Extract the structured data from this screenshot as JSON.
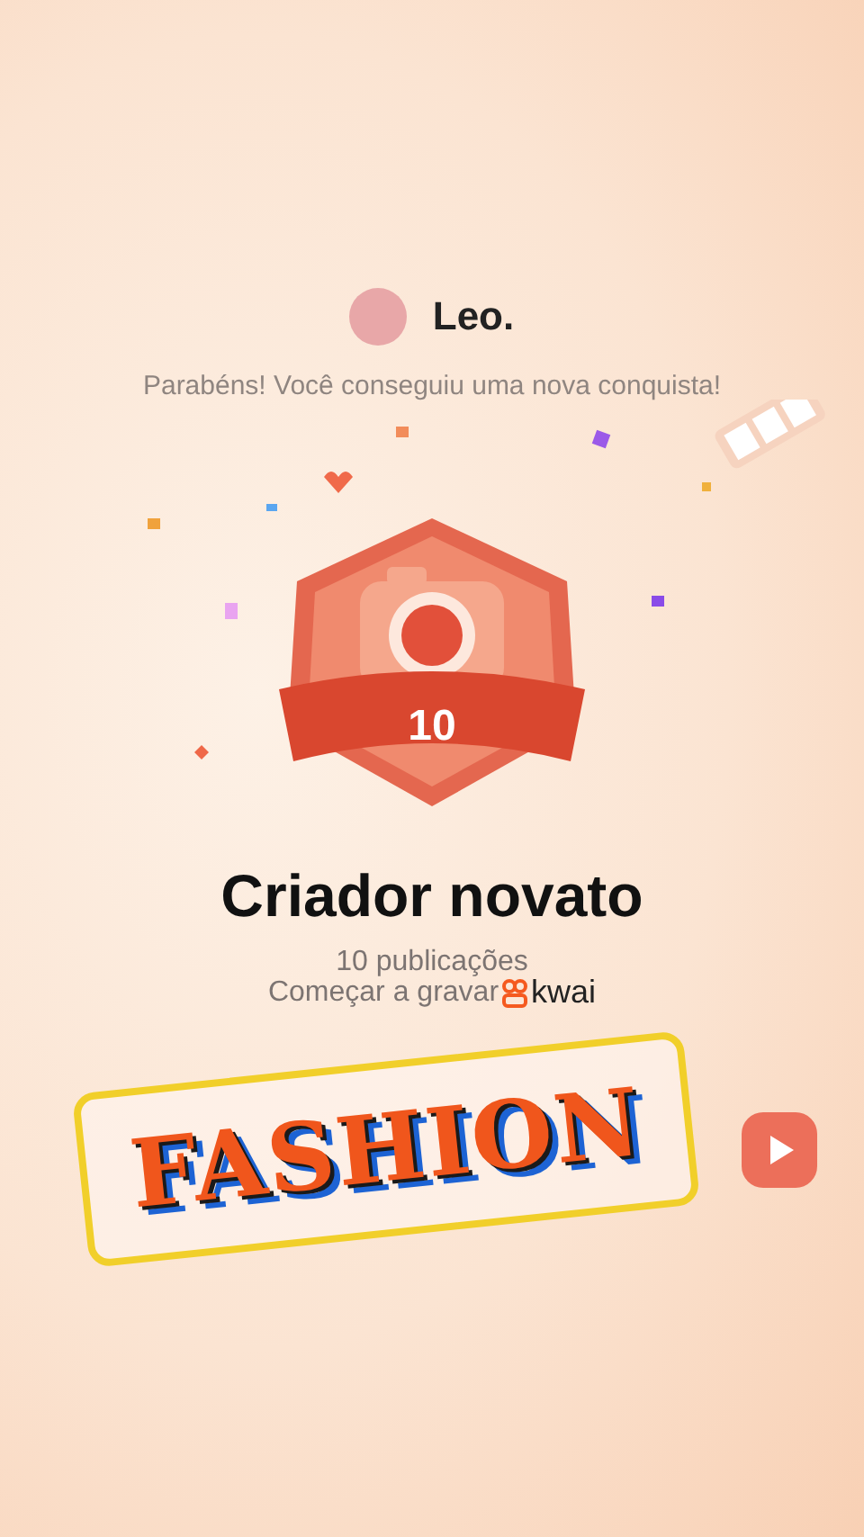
{
  "user": {
    "name": "Leo."
  },
  "message": "Parabéns! Você conseguiu uma nova conquista!",
  "badge": {
    "count": "10"
  },
  "achievement": {
    "title": "Criador novato",
    "progress": "10 publicações",
    "cta": "Começar a gravar",
    "brand": "kwai"
  },
  "sticker": {
    "text": "FASHION"
  }
}
